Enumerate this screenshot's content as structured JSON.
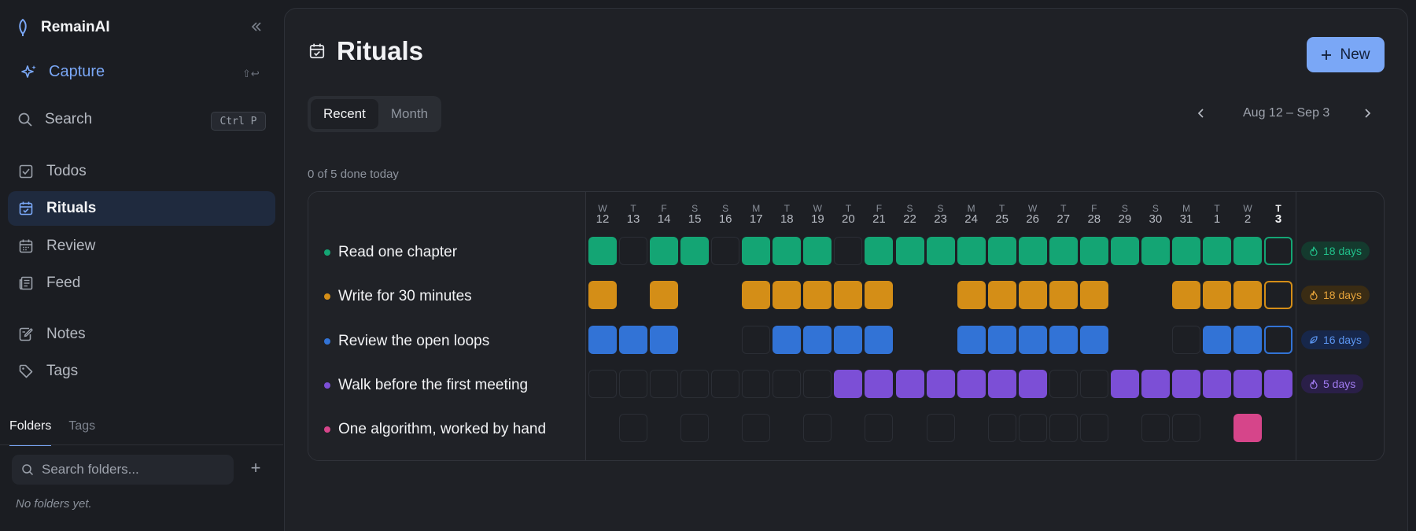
{
  "app": {
    "name": "RemainAI"
  },
  "sidebar": {
    "capture": {
      "label": "Capture",
      "shortcut": "⇧↩"
    },
    "search": {
      "label": "Search",
      "shortcut": "Ctrl P"
    },
    "nav": [
      {
        "label": "Todos",
        "icon": "checkbox-icon"
      },
      {
        "label": "Rituals",
        "icon": "calendar-check-icon",
        "active": true
      },
      {
        "label": "Review",
        "icon": "calendar-grid-icon"
      },
      {
        "label": "Feed",
        "icon": "newspaper-icon"
      },
      {
        "label": "Notes",
        "icon": "note-pen-icon"
      },
      {
        "label": "Tags",
        "icon": "tag-icon"
      }
    ],
    "tabs": [
      {
        "label": "Folders",
        "active": true
      },
      {
        "label": "Tags",
        "active": false
      }
    ],
    "folder_search": {
      "placeholder": "Search folders..."
    },
    "empty_text": "No folders yet."
  },
  "main": {
    "title": "Rituals",
    "new_button": "New",
    "view_tabs": [
      {
        "label": "Recent",
        "active": true
      },
      {
        "label": "Month",
        "active": false
      }
    ],
    "date_range": "Aug 12 – Sep 3",
    "done_today": "0 of 5 done today",
    "days": [
      {
        "dow": "W",
        "day": "12"
      },
      {
        "dow": "T",
        "day": "13"
      },
      {
        "dow": "F",
        "day": "14"
      },
      {
        "dow": "S",
        "day": "15"
      },
      {
        "dow": "S",
        "day": "16"
      },
      {
        "dow": "M",
        "day": "17"
      },
      {
        "dow": "T",
        "day": "18"
      },
      {
        "dow": "W",
        "day": "19"
      },
      {
        "dow": "T",
        "day": "20"
      },
      {
        "dow": "F",
        "day": "21"
      },
      {
        "dow": "S",
        "day": "22"
      },
      {
        "dow": "S",
        "day": "23"
      },
      {
        "dow": "M",
        "day": "24"
      },
      {
        "dow": "T",
        "day": "25"
      },
      {
        "dow": "W",
        "day": "26"
      },
      {
        "dow": "T",
        "day": "27"
      },
      {
        "dow": "F",
        "day": "28"
      },
      {
        "dow": "S",
        "day": "29"
      },
      {
        "dow": "S",
        "day": "30"
      },
      {
        "dow": "M",
        "day": "31"
      },
      {
        "dow": "T",
        "day": "1"
      },
      {
        "dow": "W",
        "day": "2"
      },
      {
        "dow": "T",
        "day": "3",
        "today": true
      }
    ],
    "rituals": [
      {
        "name": "Read one chapter",
        "color": "#14a574",
        "streak": "18 days",
        "streak_icon": "flame-icon",
        "streak_fg": "#21c08a",
        "streak_bg": "#143a2e",
        "cells": "1011011101111111111111T"
      },
      {
        "name": "Write for 30 minutes",
        "color": "#d48e17",
        "streak": "18 days",
        "streak_icon": "flame-icon",
        "streak_fg": "#e6a33a",
        "streak_bg": "#3a2c14",
        "cells": "1.1..11111..11111..111T"
      },
      {
        "name": "Review the open loops",
        "color": "#3273d6",
        "streak": "16 days",
        "streak_icon": "leaf-icon",
        "streak_fg": "#5b95f0",
        "streak_bg": "#17274a",
        "cells": "111..01111..11111..011T"
      },
      {
        "name": "Walk before the first meeting",
        "color": "#7c4fd6",
        "streak": "5 days",
        "streak_icon": "flame-icon",
        "streak_fg": "#a07bf0",
        "streak_bg": "#2a1f48",
        "cells": "00000000111111100111111T"
      },
      {
        "name": "One algorithm, worked by hand",
        "color": "#d6458a",
        "streak": "",
        "streak_icon": "",
        "streak_fg": "#d6458a",
        "streak_bg": "",
        "cells": ".0.0.0.0.0.0.0000.00.1.T"
      }
    ]
  }
}
